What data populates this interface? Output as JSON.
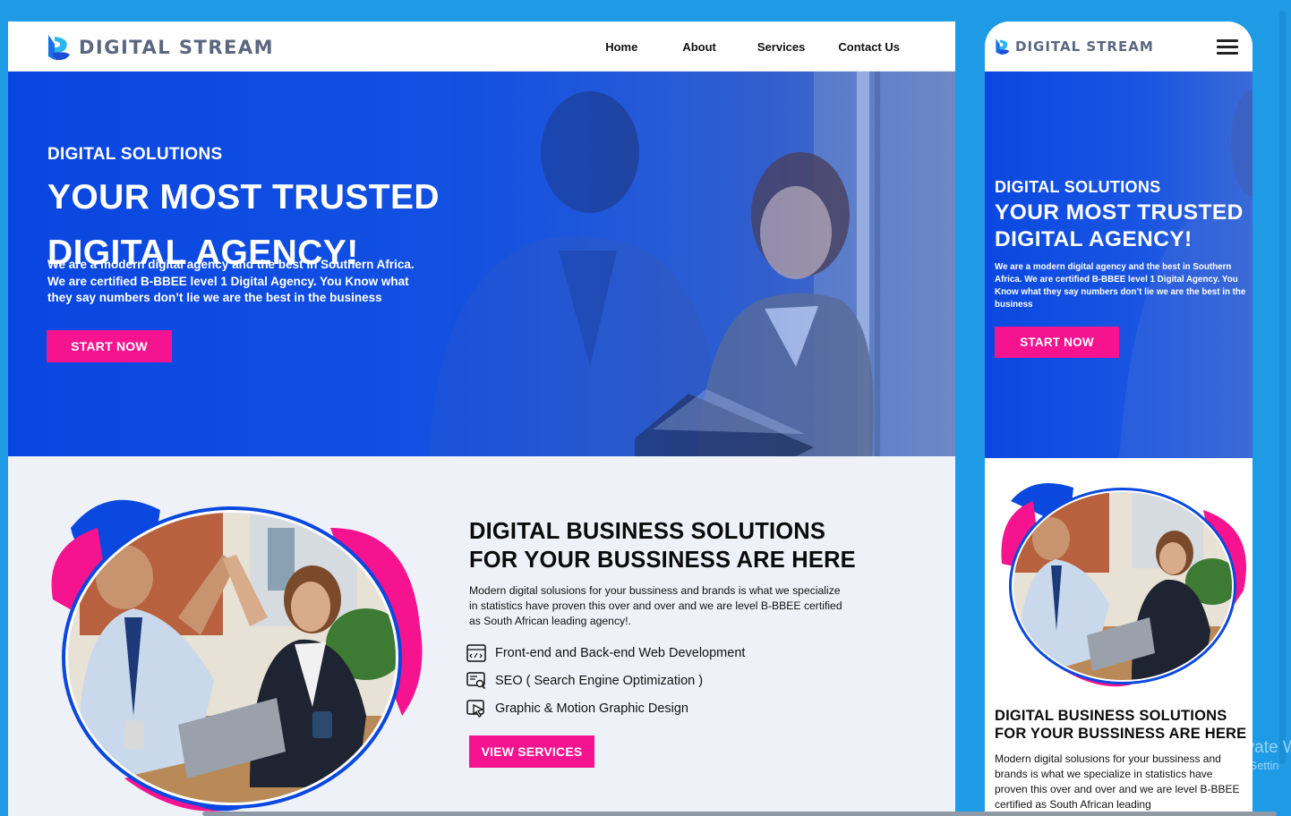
{
  "brand": {
    "name": "DIGITAL STREAM"
  },
  "nav": {
    "home": "Home",
    "about": "About",
    "services": "Services",
    "contact": "Contact Us"
  },
  "hero": {
    "pretitle": "DIGITAL SOLUTIONS",
    "title": "YOUR MOST TRUSTED DIGITAL AGENCY!",
    "description": "We are a modern digital agency and the best in Southern Africa. We are certified B-BBEE level 1 Digital Agency. You Know what they say numbers don’t lie we are the best in the business",
    "cta": "START NOW"
  },
  "about": {
    "title": "DIGITAL BUSINESS SOLUTIONS FOR YOUR BUSSINESS ARE HERE",
    "description": "Modern digital solusions for your bussiness and brands is what we specialize in statistics have proven this over and over and we are level B-BBEE certified as South African leading agency!.",
    "services": [
      {
        "label": "Front-end and Back-end Web Development",
        "icon": "code-window-icon"
      },
      {
        "label": "SEO ( Search Engine Optimization )",
        "icon": "seo-search-icon"
      },
      {
        "label": "Graphic & Motion Graphic Design",
        "icon": "design-cursor-icon"
      }
    ],
    "cta": "VIEW SERVICES"
  },
  "mobile": {
    "about_description": "Modern digital solusions for your bussiness and brands is what we specialize in statistics have proven this over and over and we are level B-BBEE certified as South African leading"
  },
  "watermark": {
    "line1": "Activate W",
    "line2": "Go to Settin"
  },
  "colors": {
    "primary_blue": "#0a48e0",
    "accent_pink": "#f5138f",
    "background": "#1f9be6",
    "section_bg": "#eef1f8"
  }
}
